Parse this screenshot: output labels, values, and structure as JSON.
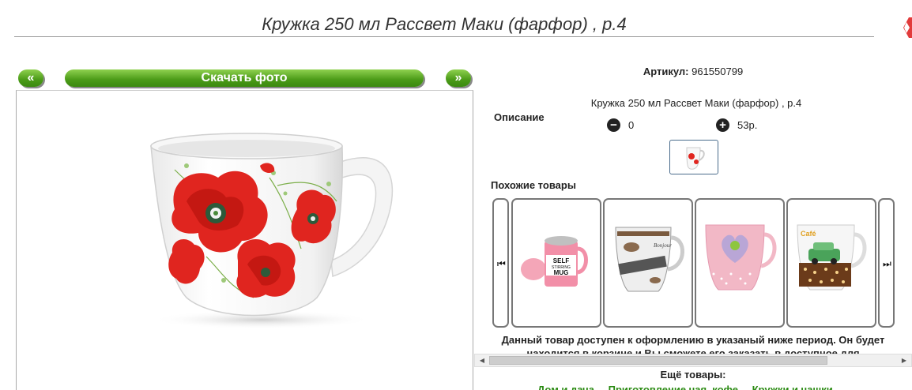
{
  "page": {
    "title": "Кружка 250 мл Рассвет Маки (фарфор) , р.4"
  },
  "nav": {
    "prev_label": "«",
    "download_label": "Скачать фото",
    "next_label": "»"
  },
  "product": {
    "article_label": "Артикул:",
    "article_value": "961550799",
    "description_label": "Описание",
    "description_text": "Кружка 250 мл Рассвет Маки (фарфор) , р.4",
    "minus_symbol": "−",
    "plus_symbol": "+",
    "quantity": "0",
    "price": "53р."
  },
  "similar": {
    "title": "Похожие товары",
    "prev_arrow": "⏮",
    "next_arrow": "⏭",
    "items": [
      {
        "name": "self-stirring-mug-item",
        "text": "SELF STIRRING MUG"
      },
      {
        "name": "bonjour-mug-item",
        "text": "Bonjour"
      },
      {
        "name": "heart-mug-item",
        "text": ""
      },
      {
        "name": "car-mug-item",
        "text": "Café"
      }
    ]
  },
  "availability_text": "Данный товар доступен к оформлению в указаный ниже период. Он будет находится в корзине и Вы сможете его заказать в доступное для",
  "more": {
    "title": "Ещё товары:",
    "links": [
      "Дом и дача",
      "Приготовление чая, кофе",
      "Кружки и чашки"
    ]
  },
  "colors": {
    "accent_green": "#4a9a17",
    "close_red": "#e23b3b"
  }
}
